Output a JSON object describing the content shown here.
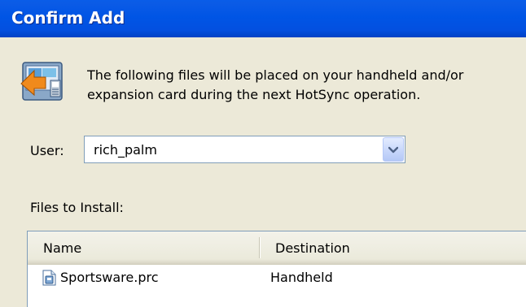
{
  "window": {
    "title": "Confirm Add"
  },
  "intro": {
    "line1": "The following files will be placed on your handheld and/or",
    "line2": "expansion card during the next HotSync operation.",
    "icon": "hotsync-install-icon"
  },
  "user": {
    "label": "User:",
    "selected": "rich_palm",
    "dropdown_icon": "chevron-down-icon"
  },
  "files": {
    "label": "Files to Install:",
    "columns": [
      "Name",
      "Destination"
    ],
    "rows": [
      {
        "name": "Sportsware.prc",
        "destination": "Handheld",
        "icon": "prc-file-icon"
      }
    ]
  },
  "colors": {
    "titlebar": "#0055e5",
    "dialog_bg": "#ece9d8",
    "field_border": "#7f9db9"
  }
}
